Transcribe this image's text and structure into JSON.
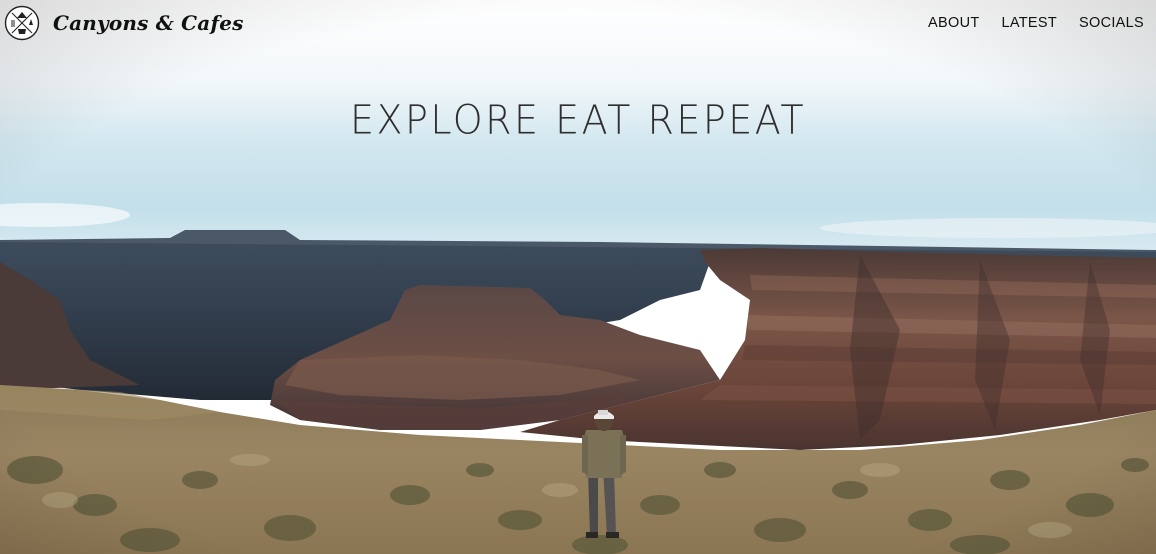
{
  "nav": {
    "brand_name": "Canyons & Cafes",
    "logo_icon": "compass-logo-icon",
    "links": [
      {
        "label": "ABOUT"
      },
      {
        "label": "LATEST"
      },
      {
        "label": "SOCIALS"
      }
    ]
  },
  "hero": {
    "title": "EXPLORE EAT REPEAT",
    "image_icon": "canyon-landscape-photo"
  },
  "colors": {
    "text": "#111111",
    "title": "#2e2e2e",
    "sky_top": "#ffffff",
    "sky_bottom": "#cfe6ef",
    "rock": "#6e4a3c",
    "ground": "#9a8562"
  }
}
